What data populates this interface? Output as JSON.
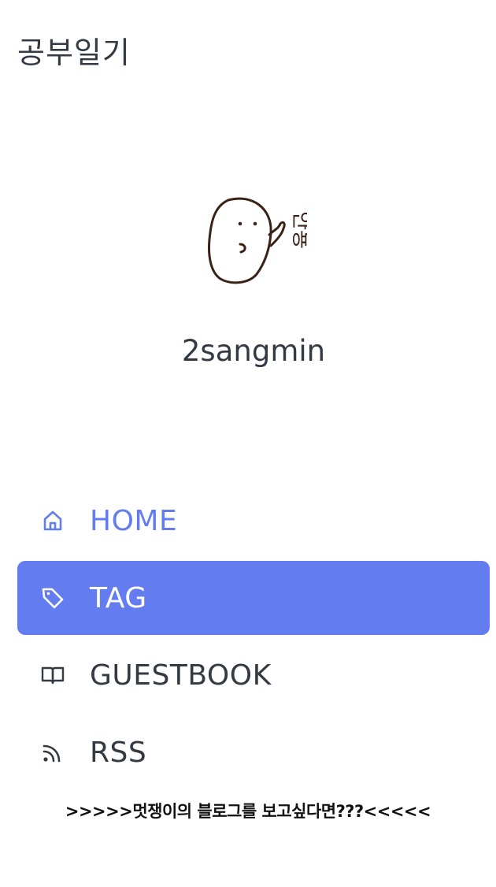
{
  "header": {
    "blog_title": "공부일기"
  },
  "profile": {
    "avatar_text": "안뇽",
    "username": "2sangmin"
  },
  "nav": {
    "items": [
      {
        "label": "HOME",
        "icon": "home-icon"
      },
      {
        "label": "TAG",
        "icon": "tag-icon",
        "active": true
      },
      {
        "label": "GUESTBOOK",
        "icon": "book-icon"
      },
      {
        "label": "RSS",
        "icon": "rss-icon"
      }
    ]
  },
  "promo": {
    "text": ">>>>>멋쟁이의 블로그를 보고싶다면???<<<<<"
  },
  "colors": {
    "accent": "#637df0",
    "text": "#333a44",
    "avatar_stroke": "#3a2216"
  }
}
